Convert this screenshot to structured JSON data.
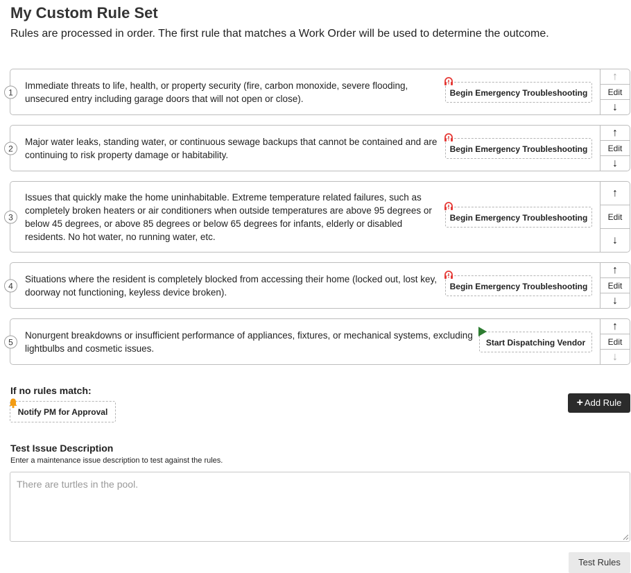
{
  "title": "My Custom Rule Set",
  "subtitle": "Rules are processed in order. The first rule that matches a Work Order will be used to determine the outcome.",
  "rules": [
    {
      "number": "1",
      "text": "Immediate threats to life, health, or property security (fire, carbon monoxide, severe flooding, unsecured entry including garage doors that will not open or close).",
      "action": "Begin Emergency Troubleshooting",
      "action_icon": "emergency-headset-icon"
    },
    {
      "number": "2",
      "text": "Major water leaks, standing water, or continuous sewage backups that cannot be contained and are continuing to risk property damage or habitability.",
      "action": "Begin Emergency Troubleshooting",
      "action_icon": "emergency-headset-icon"
    },
    {
      "number": "3",
      "text": "Issues that quickly make the home uninhabitable. Extreme temperature related failures, such as completely broken heaters or air conditioners when outside temperatures are above 95 degrees or below 45 degrees, or above 85 degrees or below 65 degrees for infants, elderly or disabled residents. No hot water, no running water, etc.",
      "action": "Begin Emergency Troubleshooting",
      "action_icon": "emergency-headset-icon"
    },
    {
      "number": "4",
      "text": "Situations where the resident is completely blocked from accessing their home (locked out, lost key, doorway not functioning, keyless device broken).",
      "action": "Begin Emergency Troubleshooting",
      "action_icon": "emergency-headset-icon"
    },
    {
      "number": "5",
      "text": "Nonurgent breakdowns or insufficient performance of appliances, fixtures, or mechanical systems, excluding lightbulbs and cosmetic issues.",
      "action": "Start Dispatching Vendor",
      "action_icon": "play-icon"
    }
  ],
  "controls": {
    "up": "↑",
    "edit": "Edit",
    "down": "↓"
  },
  "no_match": {
    "label": "If no rules match:",
    "action": "Notify PM for Approval",
    "icon": "bell-icon"
  },
  "add_rule": {
    "plus": "+",
    "label": "Add Rule"
  },
  "test": {
    "label": "Test Issue Description",
    "help": "Enter a maintenance issue description to test against the rules.",
    "placeholder": "There are turtles in the pool.",
    "button": "Test Rules"
  },
  "colors": {
    "emergency": "#e53935",
    "dispatch": "#2e7d32",
    "bell": "#f39c12",
    "add_rule_bg": "#2b2b2b"
  }
}
